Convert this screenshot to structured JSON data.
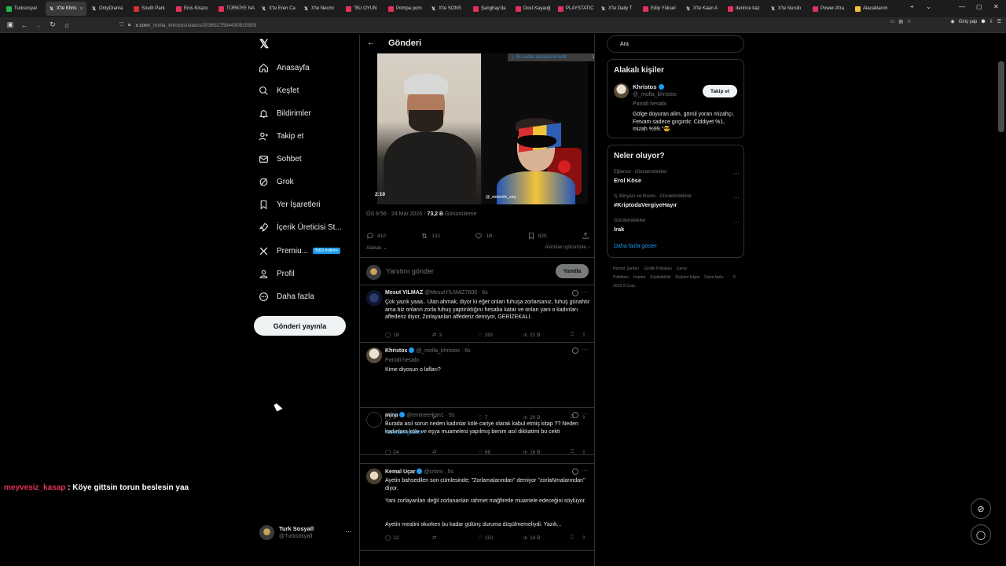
{
  "browser": {
    "tabs": [
      {
        "label": "Turksosyal",
        "color": "#2bb24c",
        "active": false
      },
      {
        "label": "X'te Khris",
        "color": "x",
        "active": true
      },
      {
        "label": "OnlyDrama",
        "color": "x",
        "active": false
      },
      {
        "label": "South Park",
        "color": "#d62f2f",
        "active": false
      },
      {
        "label": "Enis Kirazo",
        "color": "#e0325a",
        "active": false
      },
      {
        "label": "TÜRKİYE NA",
        "color": "#e0325a",
        "active": false
      },
      {
        "label": "X'te Eren Ca",
        "color": "x",
        "active": false
      },
      {
        "label": "X'te Necmi",
        "color": "x",
        "active": false
      },
      {
        "label": "\"BU OYUN",
        "color": "#e0325a",
        "active": false
      },
      {
        "label": "Pompa porn",
        "color": "#e0325a",
        "active": false
      },
      {
        "label": "X'te SONS",
        "color": "x",
        "active": false
      },
      {
        "label": "Şanghay'da",
        "color": "#e0325a",
        "active": false
      },
      {
        "label": "Dost Kayaoğ",
        "color": "#e0325a",
        "active": false
      },
      {
        "label": "PLAYSTATIC",
        "color": "#e0325a",
        "active": false
      },
      {
        "label": "X'te Daily T",
        "color": "x",
        "active": false
      },
      {
        "label": "Edip Yüksel",
        "color": "#e0325a",
        "active": false
      },
      {
        "label": "X'te Kaan A",
        "color": "x",
        "active": false
      },
      {
        "label": "derince kaz",
        "color": "#e0325a",
        "active": false
      },
      {
        "label": "X'te Nurullı",
        "color": "x",
        "active": false
      },
      {
        "label": "Power-Xtra",
        "color": "#e0325a",
        "active": false
      },
      {
        "label": "Alacaklarım",
        "color": "#f2c23a",
        "active": false
      }
    ],
    "url_host": "x.com",
    "url_path": "/_molla_khristos/status/2036517584430915905",
    "sign_in": "Giriş yap"
  },
  "nav": {
    "items": [
      {
        "label": "Anasayfa",
        "icon": "home-icon"
      },
      {
        "label": "Keşfet",
        "icon": "search-icon"
      },
      {
        "label": "Bildirimler",
        "icon": "bell-icon"
      },
      {
        "label": "Takip et",
        "icon": "follow-icon"
      },
      {
        "label": "Sohbet",
        "icon": "mail-icon"
      },
      {
        "label": "Grok",
        "icon": "grok-icon"
      },
      {
        "label": "Yer İşaretleri",
        "icon": "bookmark-icon"
      },
      {
        "label": "İçerik Üreticisi St...",
        "icon": "rocket-icon"
      },
      {
        "label": "Premiu...",
        "icon": "x-icon"
      },
      {
        "label": "Profil",
        "icon": "person-icon"
      },
      {
        "label": "Daha fazla",
        "icon": "more-circle-icon"
      }
    ],
    "premium_badge": "%50 indirim",
    "post_button": "Gönderi yayınla",
    "account": {
      "name": "Turk Sosyall",
      "handle": "@Turksosyall"
    }
  },
  "main": {
    "title": "Gönderi",
    "download_banner": "Bu video dosyasını indir",
    "download_banner_extra": "2",
    "video_time": "2:10",
    "video_watermark": "@_stelzmile_seq",
    "meta_time": "ÖS 9:56 · 24 Mar 2026 · ",
    "meta_views": "73,2 B",
    "meta_views_label": " Görüntüleme",
    "stats": {
      "replies": "410",
      "reposts": "131",
      "likes": "1B",
      "bookmarks": "825"
    },
    "relevant": "Alakalı",
    "quotes": "Alıntıları görüntüle",
    "reply_placeholder": "Yanıtını gönder",
    "reply_button": "Yanıtla",
    "replies": [
      {
        "name": "Mesut YILMAZ",
        "handle": "@MesutYILMAZ7606 · 6s",
        "text": "Çok yazık yaaa.. Ulan ahmak, diyor ki eğer onları fuhuşa zorlarsanız, fuhuş günahtır ama biz onların zorla fuhuş yaptırıldığını hesaba katar ve onları yani o kadınları affederiz diyor, Zorlayanları affederiz demiyor, GERİZEKALI.",
        "replies": "19",
        "reposts": "3",
        "likes": "392",
        "views": "21 B"
      },
      {
        "name": "Khristos",
        "handle": "@_molla_khristos · 6s",
        "parody": "Parodi hesabı",
        "text": "Kime diyosun o lafları?",
        "replies": "9",
        "reposts": "",
        "likes": "7",
        "views": "20 B",
        "show_replies": "Yanıtları göster"
      },
      {
        "name": "mina",
        "handle": "@emineerkan1 · 5s",
        "text": "Burada asıl sorun neden kadınlar köle cariye olarak kabul etmiş kitap ?? Neden kadınlara köle ve eşya muamelesi yapılmış benim asıl dikkatimi bu cekti",
        "replies": "24",
        "reposts": "",
        "likes": "68",
        "views": "16 B"
      },
      {
        "name": "Kemal Uçar",
        "handle": "@crkmi · 5s",
        "text_lines": [
          "Ayetin bahsedilen son cümlesinde; \"Zorlamalarından\" demiyor \"zorlaNmalarından\" diyor.",
          "Yani zorlayanları değil zorlananları rahmet mağfiretle muamele edeceğini söylüyor.",
          "Ayetin mealini okurken bu kadar gülünç duruma düşülmemeliydi. Yazık..."
        ],
        "replies": "12",
        "reposts": "",
        "likes": "110",
        "views": "18 B"
      }
    ]
  },
  "sidebar": {
    "search_placeholder": "Ara",
    "related_title": "Alakalı kişiler",
    "related_person": {
      "name": "Khristos",
      "handle": "@_molla_khristos",
      "parody": "Parodi hesabı",
      "bio": "Gölge doyuran alim, gönül yoran mizahçı. Fetvam sadece gırgırdır. Ciddiyet %1, mizah %99.\"😎",
      "follow": "Takip et"
    },
    "trends_title": "Neler oluyor?",
    "trends": [
      {
        "context": "Eğlence · Gündemdekiler",
        "topic": "Erol Köse"
      },
      {
        "context": "İş dünyası ve finans · Gündemdekiler",
        "topic": "#KriptodaVergiyeHayır"
      },
      {
        "context": "Gündemdekiler",
        "topic": "Irak"
      }
    ],
    "show_more": "Daha fazla göster",
    "footer": [
      "Hizmet Şartları",
      "Gizlilik Politikası",
      "Çerez Politikası",
      "Imprint",
      "Erişilebilirlik",
      "Reklam bilgisi",
      "Daha fazla ···",
      "© 2026 X Corp."
    ]
  },
  "overlay": {
    "chat_user": "meyvesiz_kasap",
    "chat_message": " : Köye gittsin torun beslesin yaa"
  }
}
